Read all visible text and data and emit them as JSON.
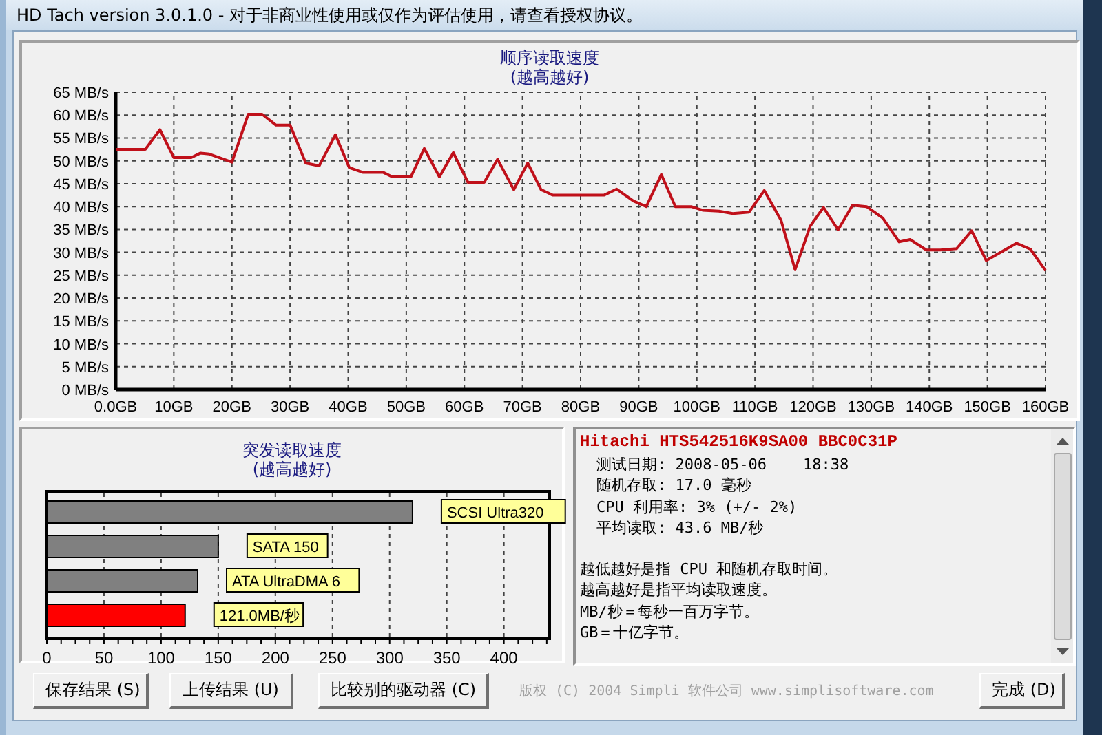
{
  "window": {
    "title": "HD Tach version 3.0.1.0  - 对于非商业性使用或仅作为评估使用，请查看授权协议。"
  },
  "sequential_read": {
    "title": "顺序读取速度",
    "subtitle": "(越高越好)",
    "chart_data": {
      "type": "line",
      "grid": true,
      "xlim": [
        0,
        160
      ],
      "ylim": [
        0,
        65
      ],
      "xticks": [
        {
          "value": 0,
          "label": "0.0GB"
        },
        {
          "value": 10,
          "label": "10GB"
        },
        {
          "value": 20,
          "label": "20GB"
        },
        {
          "value": 30,
          "label": "30GB"
        },
        {
          "value": 40,
          "label": "40GB"
        },
        {
          "value": 50,
          "label": "50GB"
        },
        {
          "value": 60,
          "label": "60GB"
        },
        {
          "value": 70,
          "label": "70GB"
        },
        {
          "value": 80,
          "label": "80GB"
        },
        {
          "value": 90,
          "label": "90GB"
        },
        {
          "value": 100,
          "label": "100GB"
        },
        {
          "value": 110,
          "label": "110GB"
        },
        {
          "value": 120,
          "label": "120GB"
        },
        {
          "value": 130,
          "label": "130GB"
        },
        {
          "value": 140,
          "label": "140GB"
        },
        {
          "value": 150,
          "label": "150GB"
        },
        {
          "value": 160,
          "label": "160GB"
        }
      ],
      "yticks": [
        {
          "value": 0,
          "label": "0 MB/s"
        },
        {
          "value": 5,
          "label": "5 MB/s"
        },
        {
          "value": 10,
          "label": "10 MB/s"
        },
        {
          "value": 15,
          "label": "15 MB/s"
        },
        {
          "value": 20,
          "label": "20 MB/s"
        },
        {
          "value": 25,
          "label": "25 MB/s"
        },
        {
          "value": 30,
          "label": "30 MB/s"
        },
        {
          "value": 35,
          "label": "35 MB/s"
        },
        {
          "value": 40,
          "label": "40 MB/s"
        },
        {
          "value": 45,
          "label": "45 MB/s"
        },
        {
          "value": 50,
          "label": "50 MB/s"
        },
        {
          "value": 55,
          "label": "55 MB/s"
        },
        {
          "value": 60,
          "label": "60 MB/s"
        },
        {
          "value": 65,
          "label": "65 MB/s"
        }
      ],
      "x": [
        0,
        5.1,
        7.6,
        10,
        13,
        14.6,
        16.1,
        20,
        22.8,
        25.2,
        27.6,
        30,
        32.7,
        35,
        37.8,
        40.2,
        42.5,
        46,
        47.6,
        50.8,
        53.1,
        55.7,
        58.1,
        60.6,
        63.4,
        65.7,
        68.5,
        70.9,
        73.2,
        74.4,
        75.2,
        84,
        86.2,
        89.1,
        91.3,
        93.9,
        96.3,
        99,
        101,
        103.8,
        106.2,
        109,
        111.6,
        114.5,
        116.9,
        119.5,
        121.8,
        124.3,
        126.8,
        129.2,
        132,
        134.8,
        136.7,
        139.5,
        141.9,
        144.7,
        147.3,
        149.8,
        155,
        157.4,
        160
      ],
      "series": [
        {
          "color": "#c0101a",
          "values": [
            52.5,
            52.5,
            56.8,
            50.7,
            50.7,
            51.7,
            51.5,
            49.7,
            60.2,
            60.2,
            57.8,
            57.8,
            49.5,
            48.9,
            55.7,
            48.5,
            47.5,
            47.5,
            46.5,
            46.5,
            52.7,
            46.5,
            51.8,
            45.3,
            45.3,
            50.3,
            43.7,
            49.5,
            43.7,
            43,
            42.5,
            42.5,
            43.8,
            41.2,
            40,
            47,
            40,
            40,
            39.2,
            39,
            38.5,
            38.8,
            43.5,
            37,
            26.2,
            35.7,
            39.8,
            34.9,
            40.3,
            40,
            37.5,
            32.3,
            32.8,
            30.5,
            30.5,
            30.8,
            34.7,
            28.2,
            32,
            30.7,
            26
          ]
        }
      ]
    }
  },
  "burst_read": {
    "title": "突发读取速度",
    "subtitle": "(越高越好)",
    "chart_data": {
      "type": "bar",
      "orientation": "horizontal",
      "grid": true,
      "xlim": [
        0,
        440
      ],
      "xticks": [
        0,
        50,
        100,
        150,
        200,
        250,
        300,
        350,
        400
      ],
      "categories": [
        "SCSI Ultra320",
        "SATA 150",
        "ATA UltraDMA 6",
        "121.0MB/秒"
      ],
      "values": [
        320,
        150,
        132,
        121
      ],
      "colors": [
        "#808080",
        "#808080",
        "#808080",
        "#ff0000"
      ]
    }
  },
  "results": {
    "drive": "Hitachi HTS542516K9SA00 BBC0C31P",
    "lines": [
      "测试日期: 2008-05-06    18:38",
      "随机存取: 17.0 毫秒",
      "CPU 利用率: 3% (+/- 2%)",
      "平均读取: 43.6 MB/秒"
    ],
    "notes": [
      "越低越好是指 CPU 和随机存取时间。",
      "越高越好是指平均读取速度。",
      "MB/秒＝每秒一百万字节。",
      "GB＝十亿字节。"
    ]
  },
  "buttons": [
    "保存结果 (S)",
    "上传结果 (U)",
    "比较别的驱动器 (C)"
  ],
  "copyright": "版权 (C) 2004 Simpli 软件公司 www.simplisoftware.com",
  "done_button": "完成 (D)"
}
